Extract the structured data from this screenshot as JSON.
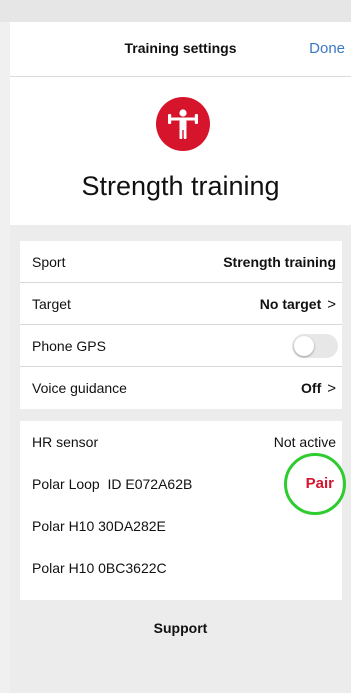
{
  "header": {
    "title": "Training settings",
    "done_label": "Done"
  },
  "hero": {
    "sport_icon": "weightlifter-icon",
    "sport_name": "Strength training",
    "icon_color": "#d6152d"
  },
  "settings": {
    "sport_label": "Sport",
    "sport_value": "Strength training",
    "target_label": "Target",
    "target_value": "No target",
    "gps_label": "Phone GPS",
    "gps_enabled": false,
    "voice_label": "Voice guidance",
    "voice_value": "Off"
  },
  "hr_sensor": {
    "label": "HR sensor",
    "status": "Not active",
    "devices": [
      {
        "name": "Polar Loop  ID E072A62B",
        "action": "Pair"
      },
      {
        "name": "Polar H10 30DA282E"
      },
      {
        "name": "Polar H10 0BC3622C"
      }
    ],
    "highlight_color": "#2ecc2e",
    "accent_color": "#d6152d"
  },
  "footer": {
    "support_label": "Support"
  },
  "icons": {
    "chevron": ">"
  }
}
